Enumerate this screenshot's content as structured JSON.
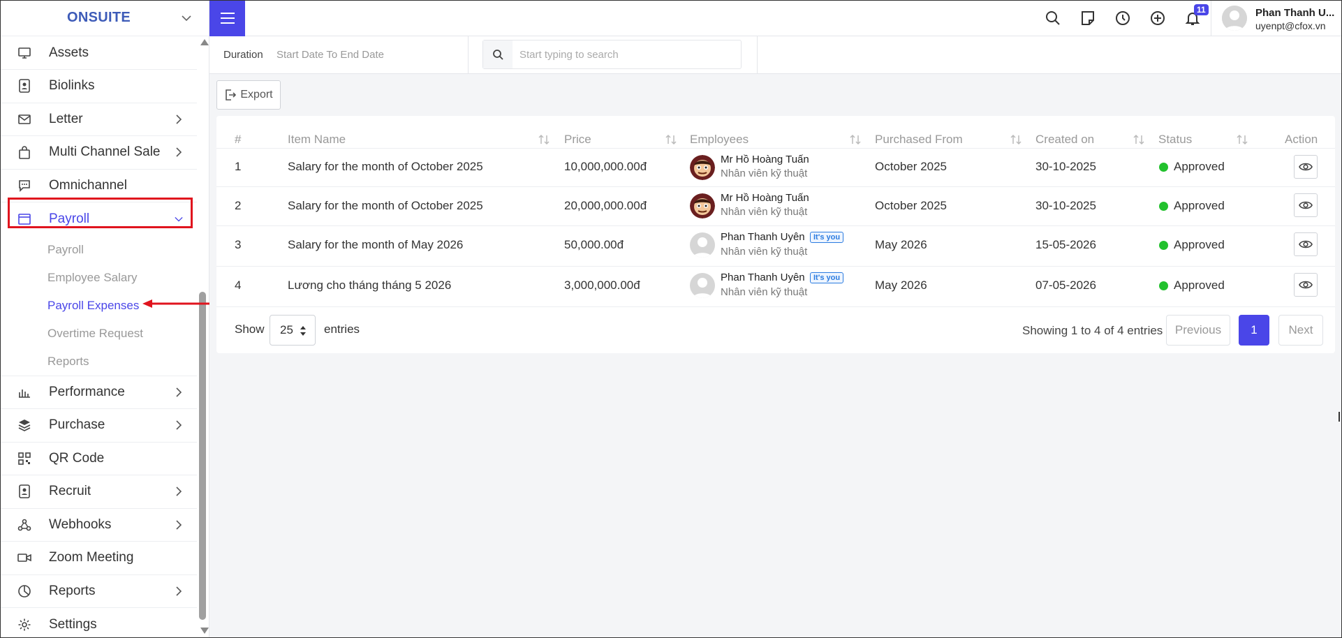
{
  "brand": {
    "name": "ONSUITE"
  },
  "sidebar": {
    "items": [
      {
        "label": "Assets",
        "icon": "monitor-icon",
        "arrow": false
      },
      {
        "label": "Biolinks",
        "icon": "id-card-icon",
        "arrow": false
      },
      {
        "label": "Letter",
        "icon": "mail-icon",
        "arrow": true
      },
      {
        "label": "Multi Channel Sale",
        "icon": "shopping-bag-icon",
        "arrow": true
      },
      {
        "label": "Omnichannel",
        "icon": "chat-icon",
        "arrow": false
      },
      {
        "label": "Payroll",
        "icon": "window-icon",
        "arrow": true,
        "active": true
      }
    ],
    "payroll_sub": [
      "Payroll",
      "Employee Salary",
      "Payroll Expenses",
      "Overtime Request",
      "Reports"
    ],
    "items_after": [
      {
        "label": "Performance",
        "icon": "bar-chart-icon",
        "arrow": true
      },
      {
        "label": "Purchase",
        "icon": "layers-icon",
        "arrow": true
      },
      {
        "label": "QR Code",
        "icon": "qr-code-icon",
        "arrow": false
      },
      {
        "label": "Recruit",
        "icon": "id-card-icon",
        "arrow": true
      },
      {
        "label": "Webhooks",
        "icon": "webhook-icon",
        "arrow": true
      },
      {
        "label": "Zoom Meeting",
        "icon": "video-icon",
        "arrow": false
      },
      {
        "label": "Reports",
        "icon": "pie-chart-icon",
        "arrow": true
      },
      {
        "label": "Settings",
        "icon": "gear-icon",
        "arrow": false
      }
    ]
  },
  "topbar": {
    "notification_count": "11",
    "user_name": "Phan Thanh U...",
    "user_email": "uyenpt@cfox.vn"
  },
  "filters": {
    "duration_label": "Duration",
    "date_placeholder": "Start Date To End Date",
    "search_placeholder": "Start typing to search"
  },
  "toolbar": {
    "export_label": "Export"
  },
  "table": {
    "headers": [
      "#",
      "Item Name",
      "Price",
      "Employees",
      "Purchased From",
      "Created on",
      "Status",
      "Action"
    ],
    "rows": [
      {
        "num": "1",
        "item": "Salary for the month of October 2025",
        "price": "10,000,000.00đ",
        "emp_name": "Mr Hồ Hoàng Tuấn",
        "emp_role": "Nhân viên kỹ thuật",
        "its_you": "",
        "purchased": "October 2025",
        "created": "30-10-2025",
        "status": "Approved",
        "avatar": "cartoon"
      },
      {
        "num": "2",
        "item": "Salary for the month of October 2025",
        "price": "20,000,000.00đ",
        "emp_name": "Mr Hồ Hoàng Tuấn",
        "emp_role": "Nhân viên kỹ thuật",
        "its_you": "",
        "purchased": "October 2025",
        "created": "30-10-2025",
        "status": "Approved",
        "avatar": "cartoon"
      },
      {
        "num": "3",
        "item": "Salary for the month of May 2026",
        "price": "50,000.00đ",
        "emp_name": "Phan Thanh Uyên",
        "emp_role": "Nhân viên kỹ thuật",
        "its_you": "It's you",
        "purchased": "May 2026",
        "created": "15-05-2026",
        "status": "Approved",
        "avatar": "default"
      },
      {
        "num": "4",
        "item": "Lương cho tháng tháng 5 2026",
        "price": "3,000,000.00đ",
        "emp_name": "Phan Thanh Uyên",
        "emp_role": "Nhân viên kỹ thuật",
        "its_you": "It's you",
        "purchased": "May 2026",
        "created": "07-05-2026",
        "status": "Approved",
        "avatar": "default"
      }
    ]
  },
  "footer": {
    "show_label": "Show",
    "page_length": "25",
    "entries_label": "entries",
    "showing_text": "Showing 1 to 4 of 4 entries",
    "previous_label": "Previous",
    "current_page": "1",
    "next_label": "Next"
  },
  "colors": {
    "accent": "#4a46e8",
    "approved": "#22c12d",
    "highlight_box": "#e0141e"
  }
}
